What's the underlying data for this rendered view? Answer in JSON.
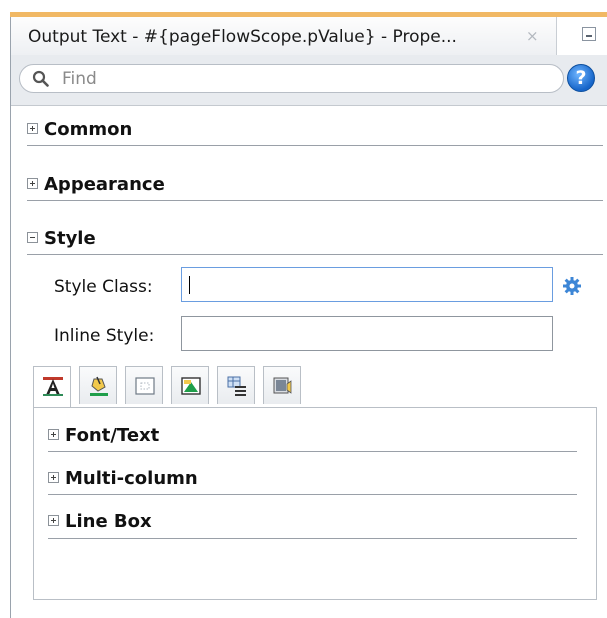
{
  "panel": {
    "title": "Output Text - #{pageFlowScope.pValue} - Prope...",
    "close_glyph": "×"
  },
  "search": {
    "placeholder": "Find",
    "help_glyph": "?"
  },
  "sections": {
    "common": "Common",
    "appearance": "Appearance",
    "style": "Style"
  },
  "style": {
    "style_class_label": "Style Class:",
    "style_class_value": "",
    "inline_style_label": "Inline Style:",
    "inline_style_value": ""
  },
  "style_tabs": [
    {
      "icon": "text-format-icon"
    },
    {
      "icon": "paint-bucket-icon"
    },
    {
      "icon": "box-model-icon"
    },
    {
      "icon": "border-background-icon"
    },
    {
      "icon": "table-list-icon"
    },
    {
      "icon": "media-audio-icon"
    }
  ],
  "subsections": {
    "font_text": "Font/Text",
    "multi_column": "Multi-column",
    "line_box": "Line Box"
  },
  "colors": {
    "accent": "#f1b864",
    "input_focus_border": "#6a9de0",
    "help_blue": "#1665c9"
  }
}
